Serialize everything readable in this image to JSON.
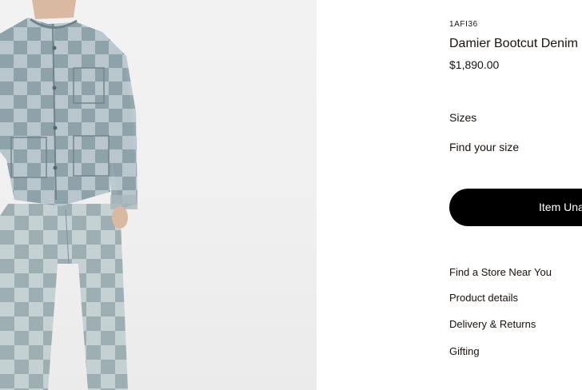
{
  "product": {
    "sku": "1AFI36",
    "title": "Damier Bootcut Denim Pants",
    "price": "$1,890.00",
    "image_alt": "Model wearing Damier denim jacket and bootcut pants"
  },
  "sizes": {
    "label": "Sizes",
    "find_size": "Find your size"
  },
  "cta": {
    "label": "Item Unavailable"
  },
  "links": [
    {
      "label": "Find a Store Near You"
    },
    {
      "label": "Product details"
    },
    {
      "label": "Delivery & Returns"
    },
    {
      "label": "Gifting"
    }
  ],
  "colors": {
    "text": "#19110b",
    "button_bg": "#000000",
    "button_text": "#ffffff",
    "image_bg": "#f0f0f0",
    "denim_light": "#b9c8cd",
    "denim_dark": "#8fa3ab"
  }
}
